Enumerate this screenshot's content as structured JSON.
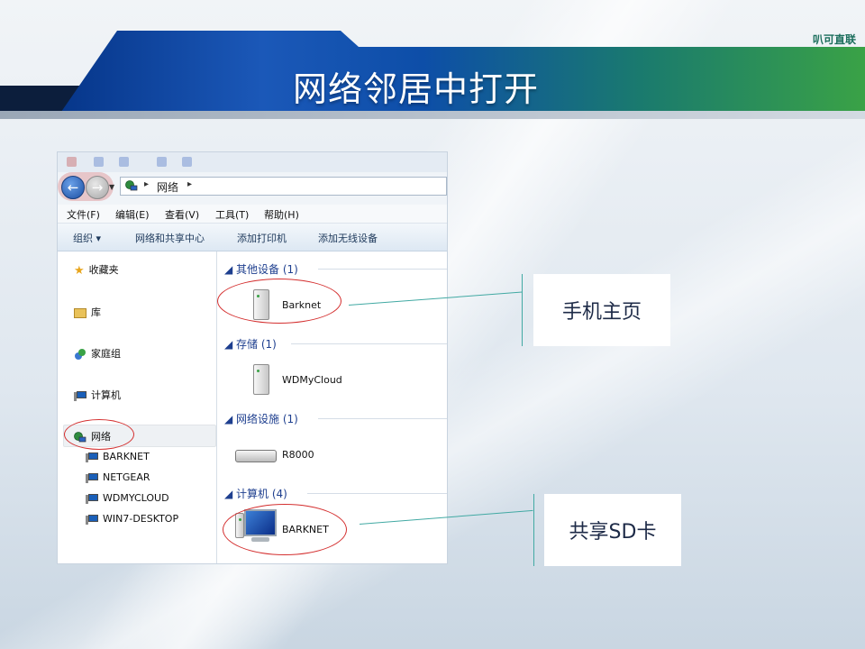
{
  "slide": {
    "title": "网络邻居中打开",
    "brand": "叭可直联"
  },
  "window": {
    "address": {
      "path": "网络"
    },
    "menu": [
      "文件(F)",
      "编辑(E)",
      "查看(V)",
      "工具(T)",
      "帮助(H)"
    ],
    "toolbar": {
      "organize": "组织 ▾",
      "network_center": "网络和共享中心",
      "add_printer": "添加打印机",
      "add_wireless": "添加无线设备"
    },
    "nav": {
      "favorites": "收藏夹",
      "library": "库",
      "homegroup": "家庭组",
      "computer": "计算机",
      "network": "网络",
      "network_children": [
        "BARKNET",
        "NETGEAR",
        "WDMYCLOUD",
        "WIN7-DESKTOP"
      ]
    },
    "groups": [
      {
        "header": "其他设备 (1)",
        "device": "Barknet"
      },
      {
        "header": "存储 (1)",
        "device": "WDMyCloud"
      },
      {
        "header": "网络设施 (1)",
        "device": "R8000"
      },
      {
        "header": "计算机 (4)",
        "device": "BARKNET"
      }
    ]
  },
  "callouts": {
    "phone_home": "手机主页",
    "shared_sd": "共享SD卡"
  },
  "colors": {
    "accent_teal": "#41a9a3",
    "ring_red": "#d42f2f",
    "group_header_blue": "#1e3f8f"
  }
}
